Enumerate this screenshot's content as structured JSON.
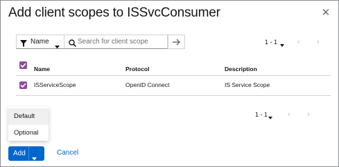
{
  "modal": {
    "title": "Add client scopes to ISSvcConsumer"
  },
  "toolbar": {
    "filter_label": "Name",
    "search_placeholder": "Search for client scope",
    "search_value": ""
  },
  "pagination_top": {
    "count": "1 - 1"
  },
  "pagination_bottom": {
    "count": "1 - 1"
  },
  "table": {
    "headers": [
      "Name",
      "Protocol",
      "Description"
    ],
    "header_checkbox_checked": true,
    "rows": [
      {
        "name": "ISServiceScope",
        "protocol": "OpenID Connect",
        "description": "IS Service Scope",
        "checked": true
      }
    ]
  },
  "dropdown_menu": {
    "items": [
      "Default",
      "Optional"
    ],
    "highlighted": "Default"
  },
  "footer": {
    "add_label": "Add",
    "cancel_label": "Cancel"
  },
  "colors": {
    "primary": "#0066cc",
    "checkbox": "#8d4ea0",
    "border": "#d2d2d2",
    "text": "#151515"
  }
}
